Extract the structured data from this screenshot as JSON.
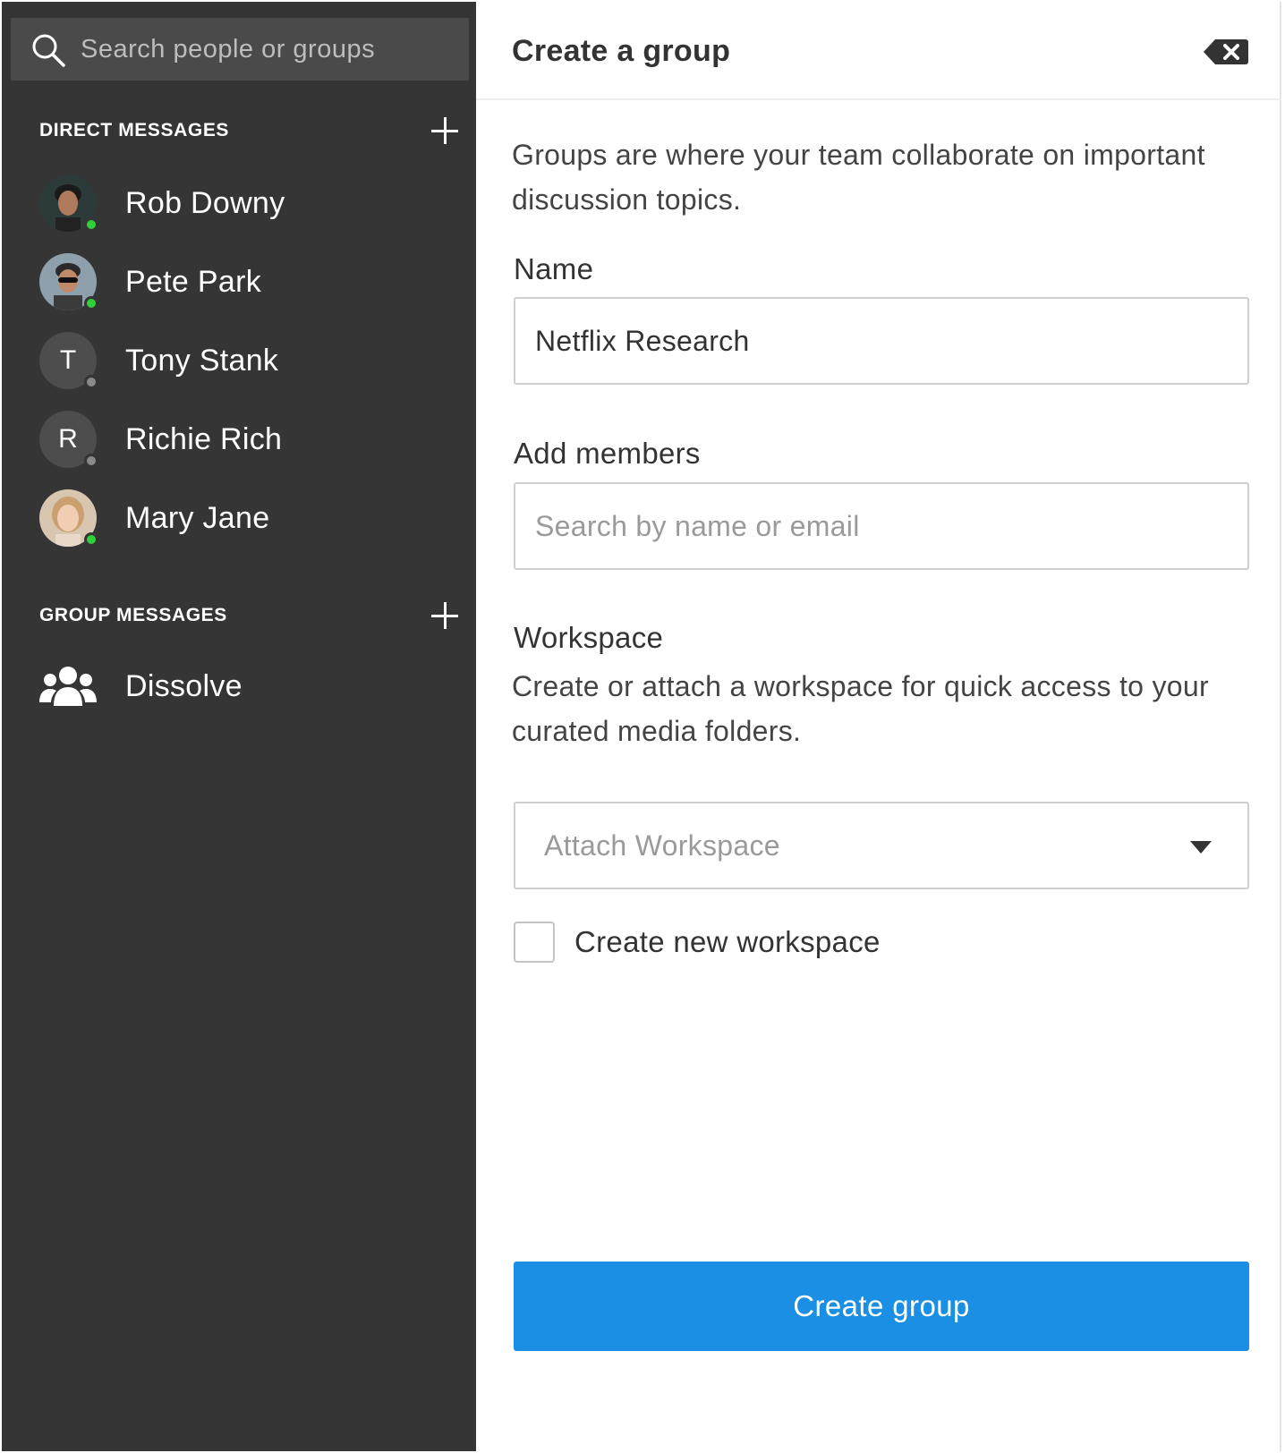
{
  "sidebar": {
    "search_placeholder": "Search people or groups",
    "direct_messages": {
      "title": "DIRECT MESSAGES",
      "items": [
        {
          "name": "Rob Downy",
          "status": "online",
          "avatar": "photo"
        },
        {
          "name": "Pete Park",
          "status": "online",
          "avatar": "photo"
        },
        {
          "name": "Tony Stank",
          "status": "offline",
          "avatar": "T"
        },
        {
          "name": "Richie Rich",
          "status": "offline",
          "avatar": "R"
        },
        {
          "name": "Mary Jane",
          "status": "online",
          "avatar": "photo"
        }
      ]
    },
    "group_messages": {
      "title": "GROUP MESSAGES",
      "items": [
        {
          "name": "Dissolve",
          "icon": "users-icon"
        }
      ]
    }
  },
  "panel": {
    "title": "Create a group",
    "description": "Groups are where your team collaborate on important discussion topics.",
    "name_label": "Name",
    "name_value": "Netflix Research",
    "members_label": "Add members",
    "members_placeholder": "Search by name or email",
    "workspace_label": "Workspace",
    "workspace_description": "Create or attach a workspace for quick access to your curated media folders.",
    "workspace_select": "Attach Workspace",
    "new_workspace_label": "Create new workspace",
    "new_workspace_checked": false,
    "submit_label": "Create group"
  },
  "colors": {
    "sidebar_bg": "#353535",
    "search_bg": "#4a4a4a",
    "online": "#2fd03a",
    "offline": "#8a8a8a",
    "primary": "#1a8fe3"
  }
}
